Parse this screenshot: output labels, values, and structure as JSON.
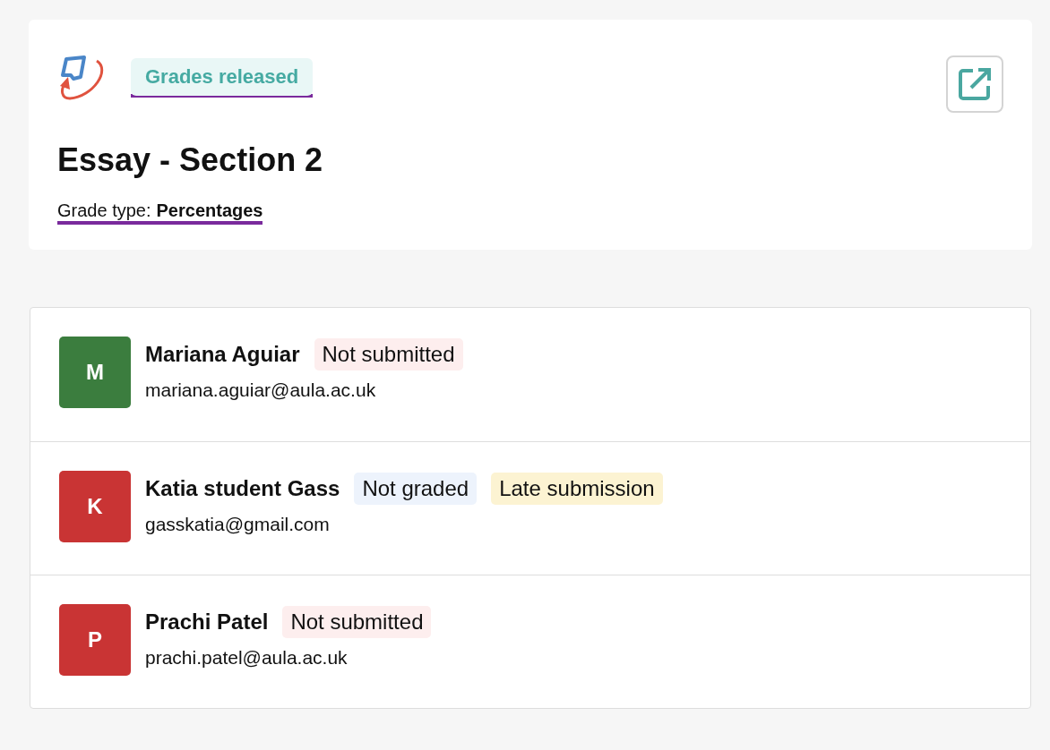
{
  "assignment": {
    "status": "Grades released",
    "title": "Essay - Section 2",
    "grade_type_label": "Grade type:",
    "grade_type": "Percentages"
  },
  "students": [
    {
      "initial": "M",
      "color": "#3b7d3e",
      "name": "Mariana Aguiar",
      "email": "mariana.aguiar@aula.ac.uk",
      "tags": [
        {
          "kind": "missing",
          "label": "Not submitted"
        }
      ]
    },
    {
      "initial": "K",
      "color": "#c93434",
      "name": "Katia student Gass",
      "email": "gasskatia@gmail.com",
      "tags": [
        {
          "kind": "ungraded",
          "label": "Not graded"
        },
        {
          "kind": "late",
          "label": "Late submission"
        }
      ]
    },
    {
      "initial": "P",
      "color": "#c93434",
      "name": "Prachi Patel",
      "email": "prachi.patel@aula.ac.uk",
      "tags": [
        {
          "kind": "missing",
          "label": "Not submitted"
        }
      ]
    }
  ]
}
